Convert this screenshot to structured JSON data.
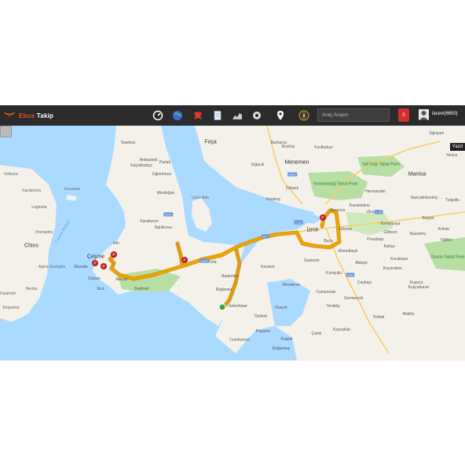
{
  "header": {
    "brand_accent": "Ebus",
    "brand_main": "Takip",
    "search_placeholder": "Araç Arayın",
    "alert_count": "0",
    "username": "lacevi(6650)"
  },
  "toolbar": {
    "icons": [
      "speedometer-icon",
      "globe-icon",
      "puzzle-icon",
      "document-icon",
      "chart-icon",
      "settings-icon",
      "location-pin-icon",
      "traffic-light-icon"
    ]
  },
  "map": {
    "overlay_label": "Yazd",
    "cities": [
      {
        "name": "İzmir",
        "major": true
      },
      {
        "name": "Manisa",
        "major": true
      },
      {
        "name": "Çeşme",
        "major": true
      },
      {
        "name": "Foça",
        "major": true
      },
      {
        "name": "Menemen",
        "major": true
      },
      {
        "name": "Urla",
        "major": false
      },
      {
        "name": "Karaburun",
        "major": false
      }
    ],
    "places": [
      "Bornova",
      "Buca",
      "Gaziemir",
      "Torbalı",
      "Kemalpaşa",
      "Menderes",
      "Seferihisar",
      "Bademler",
      "Kavacık",
      "Balıklıova",
      "Mordoğan",
      "Eğlenhoca",
      "Ambarsek",
      "Küçükbahçe",
      "Tepeboz",
      "Parlak",
      "Bağarası",
      "Bozköy",
      "Yeniköy",
      "Ulucak",
      "Pınarbaşı",
      "Kocakaya",
      "Çamlı",
      "Kaynaklar",
      "Ataköy",
      "Kuşçuburun",
      "Zeytineli",
      "Ilıca",
      "Alaçatı",
      "Musalla",
      "Dalyan",
      "Ovacık",
      "Germencik",
      "Ildır",
      "Cumhuriyet",
      "Payamlı",
      "Kuşluk",
      "Özdere",
      "Cumaovası",
      "Çaybaşı",
      "Kızılçullu",
      "Kavaklıdere",
      "Sancaklıbozköy",
      "Harmandalı",
      "Turgutlu",
      "Beşyol",
      "Kırklar",
      "Yiğitler",
      "Nazarköy",
      "Kuşuca",
      "Eğriçam",
      "Yenice",
      "Koyundere",
      "Bahçe",
      "Gökçen",
      "Sığacık",
      "Doğanbey",
      "Ahmetbeyli",
      "Orhanlı",
      "Barbaros",
      "Kızılbahçe",
      "Karakoç",
      "Aktepe",
      "Görece"
    ],
    "islands": [
      "Uzun Ada",
      "Chios",
      "Inousses",
      "Vrontados",
      "Kardamyla",
      "Lagkada",
      "Agios Georgios",
      "Emporios",
      "Volissos",
      "Nenita",
      "Kalamoti"
    ],
    "parks": [
      "Yamanlardağ Tabiat Parkı",
      "Spil Dağı Tabiat Parkı",
      "Ovacık Tabiat Parkı"
    ],
    "sea_labels": [
      "Çeşme Boğazı"
    ],
    "roads": [
      "E87",
      "D300",
      "O-32",
      "E881",
      "D550",
      "O-30",
      "D505"
    ],
    "route_color": "#f0a500",
    "parking_stops": 5,
    "start_marker": 1
  }
}
